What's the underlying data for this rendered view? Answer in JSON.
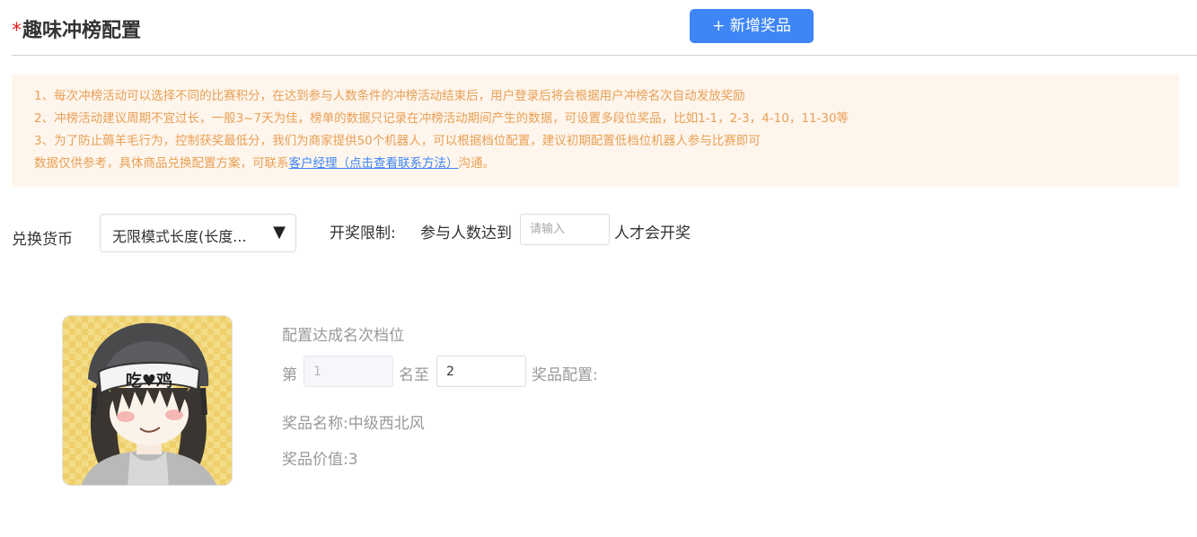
{
  "header": {
    "required_mark": "*",
    "title": "趣味冲榜配置",
    "add_prize_label": "+ 新增奖品"
  },
  "notice": {
    "line1": "1、每次冲榜活动可以选择不同的比赛积分，在达到参与人数条件的冲榜活动结束后，用户登录后将会根据用户冲榜名次自动发放奖励",
    "line2": "2、冲榜活动建议周期不宜过长，一般3~7天为佳，榜单的数据只记录在冲榜活动期间产生的数据，可设置多段位奖品，比如1-1，2-3，4-10，11-30等",
    "line3": "3、为了防止薅羊毛行为，控制获奖最低分，我们为商家提供50个机器人，可以根据档位配置，建议初期配置低档位机器人参与比赛即可",
    "line4_prefix": "数据仅供参考，具体商品兑换配置方案，可联系",
    "line4_link": "客户经理（点击查看联系方法）",
    "line4_suffix": "沟通。"
  },
  "currency": {
    "label": "兑换货币",
    "selected": "无限模式长度(长度...",
    "arrow": "▼"
  },
  "draw_limit": {
    "label": "开奖限制:",
    "prefix": "参与人数达到",
    "placeholder": "请输入",
    "suffix": "人才会开奖"
  },
  "prize": {
    "image_icon": "anime-girl-helmet-image",
    "helmet_text": "吃♥鸡",
    "rank_heading": "配置达成名次档位",
    "rank_prefix": "第",
    "rank_from": "1",
    "rank_middle": "名至",
    "rank_to": "2",
    "rank_suffix": "奖品配置:",
    "name_label": "奖品名称:",
    "name_value": "中级西北风",
    "value_label": "奖品价值:",
    "value_value": "3"
  }
}
